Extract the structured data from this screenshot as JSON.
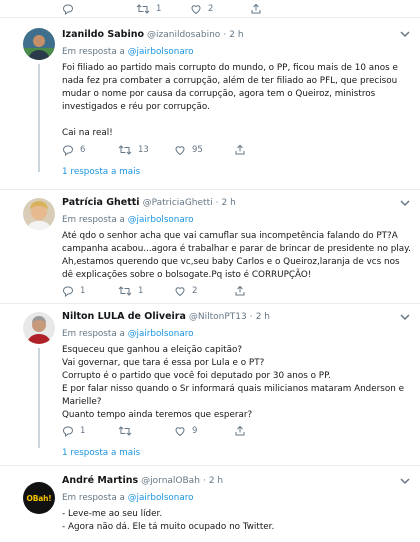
{
  "top": {
    "retweets": "1",
    "likes": "2"
  },
  "tweets": [
    {
      "name": "Izanildo Sabino",
      "handle": "@izanildosabino",
      "time": "2 h",
      "reply_prefix": "Em resposta a",
      "reply_to": "@jairbolsonaro",
      "text": "Foi filiado ao partido mais corrupto do mundo, o PP, ficou mais de 10 anos e nada fez pra combater a corrupção, além de ter filiado ao PFL, que precisou mudar o nome por causa da corrupção, agora tem o Queiroz, ministros investigados e réu por corrupção.\n\nCai na real!",
      "replies": "6",
      "retweets": "13",
      "likes": "95",
      "more": "1 resposta a mais"
    },
    {
      "name": "Patrícia Ghetti",
      "handle": "@PatriciaGhetti",
      "time": "2 h",
      "reply_prefix": "Em resposta a",
      "reply_to": "@jairbolsonaro",
      "text": "Até qdo o senhor acha que vai camuflar sua incompetência falando do PT?A campanha acabou...agora é trabalhar e parar de brincar de presidente no play. Ah,estamos querendo que vc,seu baby Carlos e o Queiroz,laranja de vcs nos dê explicações sobre o bolsogate.Pq isto é CORRUPÇÃO!",
      "replies": "1",
      "retweets": "1",
      "likes": "2",
      "more": ""
    },
    {
      "name": "Nilton LULA de Oliveira",
      "handle": "@NiltonPT13",
      "time": "2 h",
      "reply_prefix": "Em resposta a",
      "reply_to": "@jairbolsonaro",
      "text": "Esqueceu que ganhou a eleição capitão?\nVai governar, que tara é essa por Lula e o PT?\nCorrupto é o partido que você foi deputado por 30 anos o PP.\nE por falar nisso quando o Sr informará quais milicianos mataram Anderson e Marielle?\nQuanto tempo ainda teremos que esperar?",
      "replies": "1",
      "retweets": "",
      "likes": "9",
      "more": "1 resposta a mais"
    },
    {
      "name": "André Martins",
      "handle": "@jornalOBah",
      "time": "2 h",
      "reply_prefix": "Em resposta a",
      "reply_to": "@jairbolsonaro",
      "text": "- Leve-me ao seu líder.\n- Agora não dá. Ele tá muito ocupado no Twitter.",
      "avatar_text": "OBah!"
    }
  ],
  "colors": {
    "link": "#1b95e0",
    "muted": "#657786",
    "border": "#e6ecf0"
  }
}
